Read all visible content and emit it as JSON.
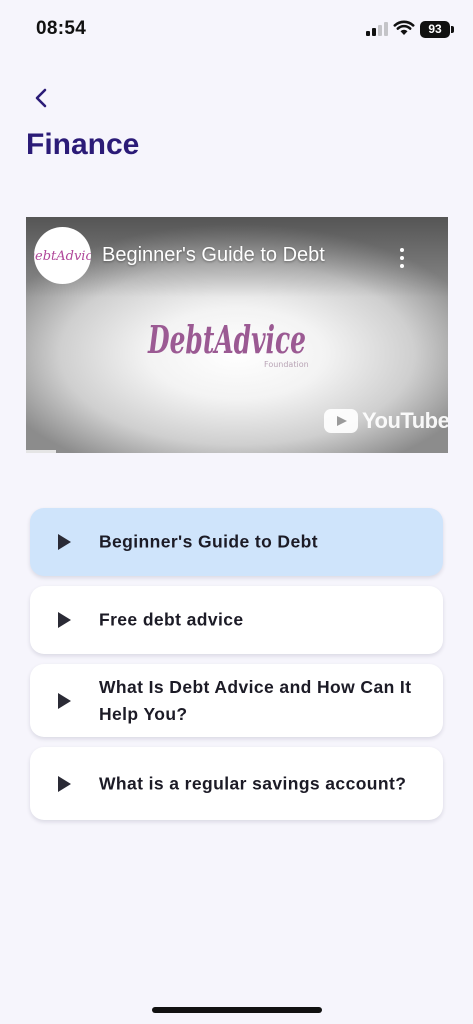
{
  "status_bar": {
    "time": "08:54",
    "battery": "93"
  },
  "header": {
    "back_icon": "chevron-left-icon",
    "title": "Finance"
  },
  "video": {
    "title": "Beginner's Guide to Debt",
    "channel_logo_text": "DebtAdvice",
    "logo_text": "DebtAdvice",
    "logo_subtext": "Foundation",
    "platform": "YouTube",
    "progress": 0.07
  },
  "videos": [
    {
      "label": "Beginner's Guide to Debt",
      "active": true
    },
    {
      "label": "Free debt advice",
      "active": false
    },
    {
      "label": "What Is Debt Advice and How Can It Help You?",
      "active": false
    },
    {
      "label": "What is a regular savings account?",
      "active": false
    }
  ],
  "colors": {
    "accent": "#2b1b77",
    "active_item": "#cfe4fb",
    "background": "#f6f5fc",
    "logo": "#9b5a93"
  }
}
